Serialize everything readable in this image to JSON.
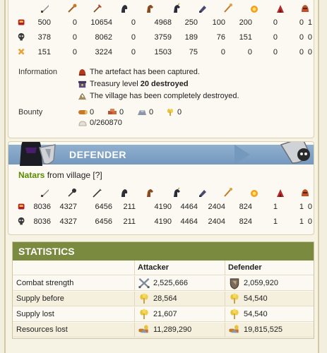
{
  "units_header_attacker": [
    "sword-icon",
    "club-icon",
    "axe-icon",
    "scout-icon",
    "horse-icon",
    "knight-icon",
    "ram-icon",
    "catapult-icon",
    "chief-icon",
    "settler-icon",
    "hero-icon"
  ],
  "attacker": {
    "rows": [
      {
        "type": "troops",
        "icon": "troops-sent-icon",
        "values": [
          "500",
          "0",
          "10654",
          "0",
          "4968",
          "250",
          "100",
          "200",
          "0",
          "0",
          "1"
        ]
      },
      {
        "type": "dead",
        "icon": "casualties-skull-icon",
        "values": [
          "378",
          "0",
          "8062",
          "0",
          "3759",
          "189",
          "76",
          "151",
          "0",
          "0",
          "0"
        ]
      },
      {
        "type": "wounded",
        "icon": "wounded-icon",
        "values": [
          "151",
          "0",
          "3224",
          "0",
          "1503",
          "75",
          "0",
          "0",
          "0",
          "0",
          "0"
        ]
      }
    ],
    "information_label": "Information",
    "info_lines": {
      "artefact": "The artefact has been captured.",
      "treasury_prefix": "Treasury level ",
      "treasury_bold": "20 destroyed",
      "village": "The village has been completely destroyed."
    },
    "bounty_label": "Bounty",
    "bounty": {
      "wood": "0",
      "clay": "0",
      "iron": "0",
      "crop": "0",
      "capacity": "0/260870"
    }
  },
  "defender": {
    "title": "DEFENDER",
    "owner_name": "Natars",
    "owner_suffix": " from village [?]",
    "units_header": [
      "sword-icon",
      "mace-icon",
      "spear-icon",
      "scout-icon",
      "horse-icon",
      "knight-icon",
      "ram-icon",
      "catapult-icon",
      "chief-icon",
      "settler-icon",
      "hero-icon"
    ],
    "rows": [
      {
        "type": "troops",
        "icon": "troops-sent-icon",
        "values": [
          "8036",
          "4327",
          "6456",
          "211",
          "4190",
          "4464",
          "2404",
          "824",
          "1",
          "1",
          "0"
        ]
      },
      {
        "type": "dead",
        "icon": "casualties-skull-icon",
        "values": [
          "8036",
          "4327",
          "6456",
          "211",
          "4190",
          "4464",
          "2404",
          "824",
          "1",
          "1",
          "0"
        ]
      }
    ]
  },
  "statistics": {
    "title": "STATISTICS",
    "col_attacker": "Attacker",
    "col_defender": "Defender",
    "rows": [
      {
        "label": "Combat strength",
        "icon_att": "crossed-swords-icon",
        "att": "2,525,666",
        "icon_def": "shield-icon",
        "def": "2,059,920"
      },
      {
        "label": "Supply before",
        "icon_att": "crop-icon",
        "att": "28,564",
        "icon_def": "crop-icon",
        "def": "54,540"
      },
      {
        "label": "Supply lost",
        "icon_att": "crop-icon",
        "att": "21,607",
        "icon_def": "crop-icon",
        "def": "54,540"
      },
      {
        "label": "Resources lost",
        "icon_att": "resources-icon",
        "att": "11,289,290",
        "icon_def": "resources-icon",
        "def": "19,815,525"
      }
    ]
  }
}
